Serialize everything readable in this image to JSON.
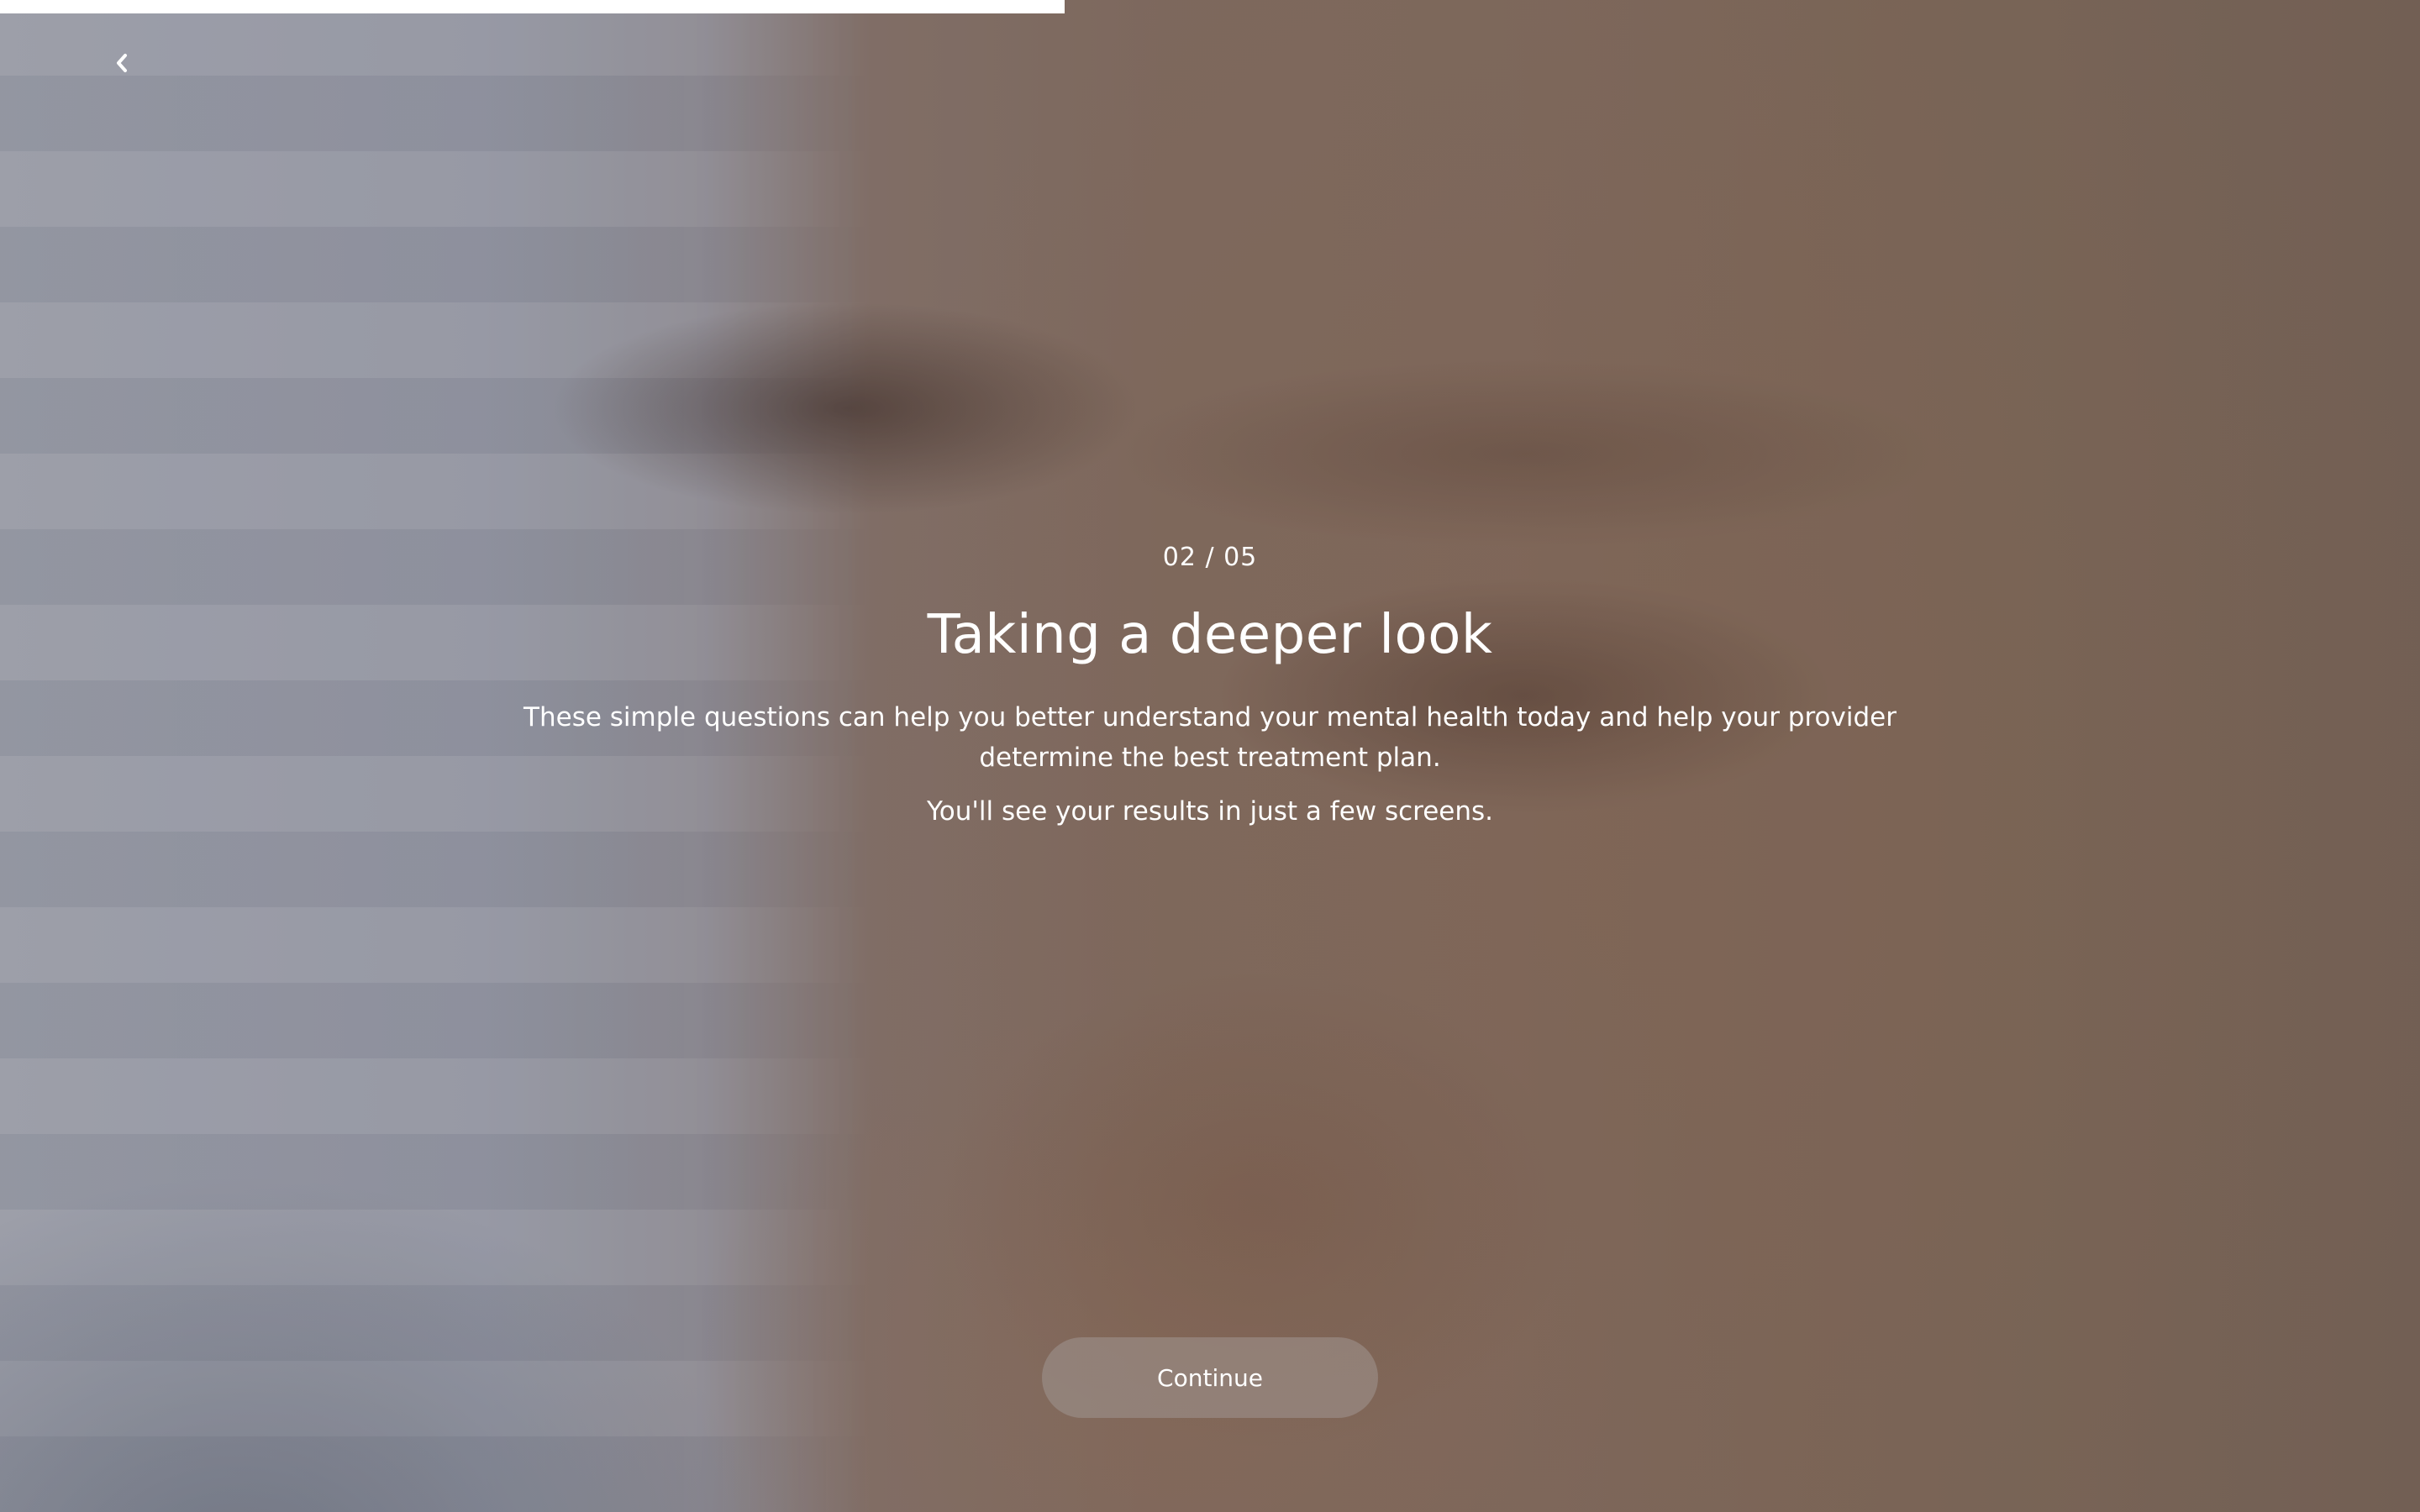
{
  "progress": {
    "fraction": 0.44
  },
  "nav": {
    "back_icon": "chevron-left-icon"
  },
  "intro": {
    "step_counter": "02 / 05",
    "title": "Taking a deeper look",
    "description": "These simple questions can help you better understand your mental health today and help your provider determine the best treatment plan.",
    "note": "You'll see your results in just a few screens."
  },
  "actions": {
    "continue_label": "Continue"
  },
  "colors": {
    "text": "#ffffff",
    "progress_fill": "#ffffff",
    "button_background": "rgba(160,150,145,0.55)"
  }
}
